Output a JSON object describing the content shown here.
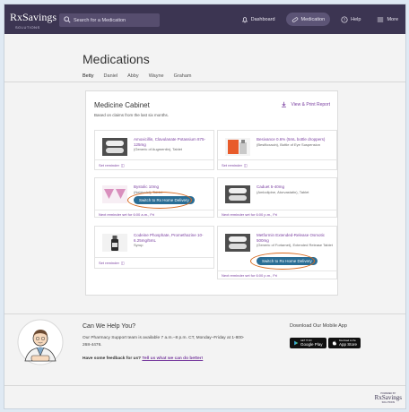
{
  "header": {
    "logo_text": "RxSavings",
    "logo_sub": "SOLUTIONS",
    "search_placeholder": "Search for a Medication",
    "nav": [
      {
        "label": "Dashboard",
        "icon": "bell-icon",
        "active": false
      },
      {
        "label": "Medication",
        "icon": "pill-icon",
        "active": true
      },
      {
        "label": "Help",
        "icon": "question-icon",
        "active": false
      },
      {
        "label": "More",
        "icon": "menu-icon",
        "active": false
      }
    ]
  },
  "page": {
    "title": "Medications",
    "tabs": [
      {
        "label": "Betty",
        "active": true
      },
      {
        "label": "Daniel",
        "active": false
      },
      {
        "label": "Abby",
        "active": false
      },
      {
        "label": "Wayne",
        "active": false
      },
      {
        "label": "Graham",
        "active": false
      }
    ]
  },
  "cabinet": {
    "title": "Medicine Cabinet",
    "subtitle": "Based on claims from the last six months.",
    "report_label": "View & Print Report",
    "delivery_label": "Switch to Rx Home Delivery",
    "cards": [
      {
        "name": "Amoxicillin, Clavulanate Potassium 875-125mg",
        "desc": "(Generic of Augmentin), Tablet",
        "footer": "Set reminder",
        "pill": "white-oval"
      },
      {
        "name": "Besivance 0.6% (5mL bottle droppers)",
        "desc": "(Besifloxacin), Bottle of Eye Suspension",
        "footer": "Set reminder",
        "pill": "eye-drop-box"
      },
      {
        "name": "Bystolic 10mg",
        "desc": "(Nebivolol), Tablet",
        "footer": "Next reminder set for 6:00 a.m., Fri",
        "pill": "pink-triangles"
      },
      {
        "name": "Caduet 5-40mg",
        "desc": "(Amlodipine, Atorvastatin), Tablet",
        "footer": "Next reminder set for 6:00 p.m., Fri",
        "pill": "white-oval"
      },
      {
        "name": "Codeine Phosphate, Promethazine 10-6.25mg/5mL",
        "desc": "Syrup",
        "footer": "Set reminder",
        "pill": "syrup-bottle"
      },
      {
        "name": "Metformin Extended-Release Osmotic 500mg",
        "desc": "(Generic of Fortamet), Extended Release Tablet",
        "footer": "Next reminder set for 6:00 p.m., Fri",
        "pill": "white-oval"
      }
    ]
  },
  "help": {
    "title": "Can We Help You?",
    "text": "Our Pharmacy Support team is available 7 a.m.–8 p.m. CT, Monday–Friday at 1-800-268-4476.",
    "feedback_prefix": "Have some feedback for us?",
    "feedback_link": "Tell us what we can do better!",
    "app_title": "Download Our Mobile App",
    "google": {
      "top": "GET IT ON",
      "name": "Google Play"
    },
    "apple": {
      "top": "Download on the",
      "name": "App Store"
    }
  },
  "footer": {
    "top": "POWERED BY",
    "name": "RxSavings",
    "sub": "SOLUTIONS"
  },
  "colors": {
    "header": "#3c3552",
    "accent": "#7a3fa0",
    "delivery_button": "#2a6d95",
    "highlight_oval": "#d7681d"
  }
}
